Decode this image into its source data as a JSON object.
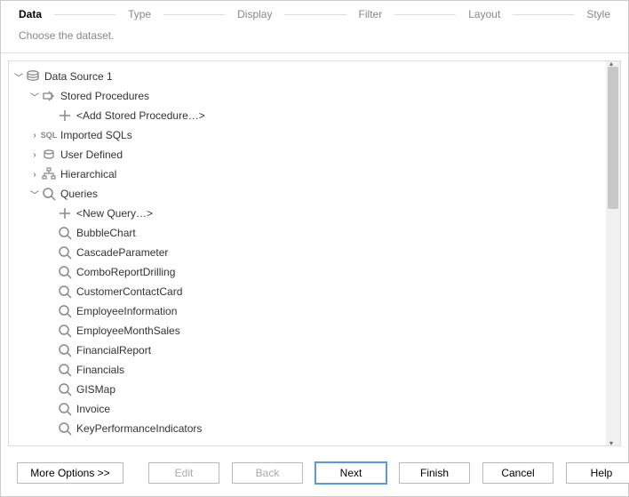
{
  "steps": {
    "active_index": 0,
    "items": [
      "Data",
      "Type",
      "Display",
      "Filter",
      "Layout",
      "Style"
    ]
  },
  "subtitle": "Choose the dataset.",
  "tree": {
    "root_label": "Data Source 1",
    "stored_procedures_label": "Stored Procedures",
    "add_stored_procedure_label": "<Add Stored Procedure…>",
    "imported_sqls_label": "Imported SQLs",
    "imported_sqls_badge": "SQL",
    "user_defined_label": "User Defined",
    "hierarchical_label": "Hierarchical",
    "queries_label": "Queries",
    "new_query_label": "<New Query…>",
    "queries": [
      "BubbleChart",
      "CascadeParameter",
      "ComboReportDrilling",
      "CustomerContactCard",
      "EmployeeInformation",
      "EmployeeMonthSales",
      "FinancialReport",
      "Financials",
      "GISMap",
      "Invoice",
      "KeyPerformanceIndicators"
    ]
  },
  "buttons": {
    "more": "More Options >>",
    "edit": "Edit",
    "back": "Back",
    "next": "Next",
    "finish": "Finish",
    "cancel": "Cancel",
    "help": "Help"
  }
}
